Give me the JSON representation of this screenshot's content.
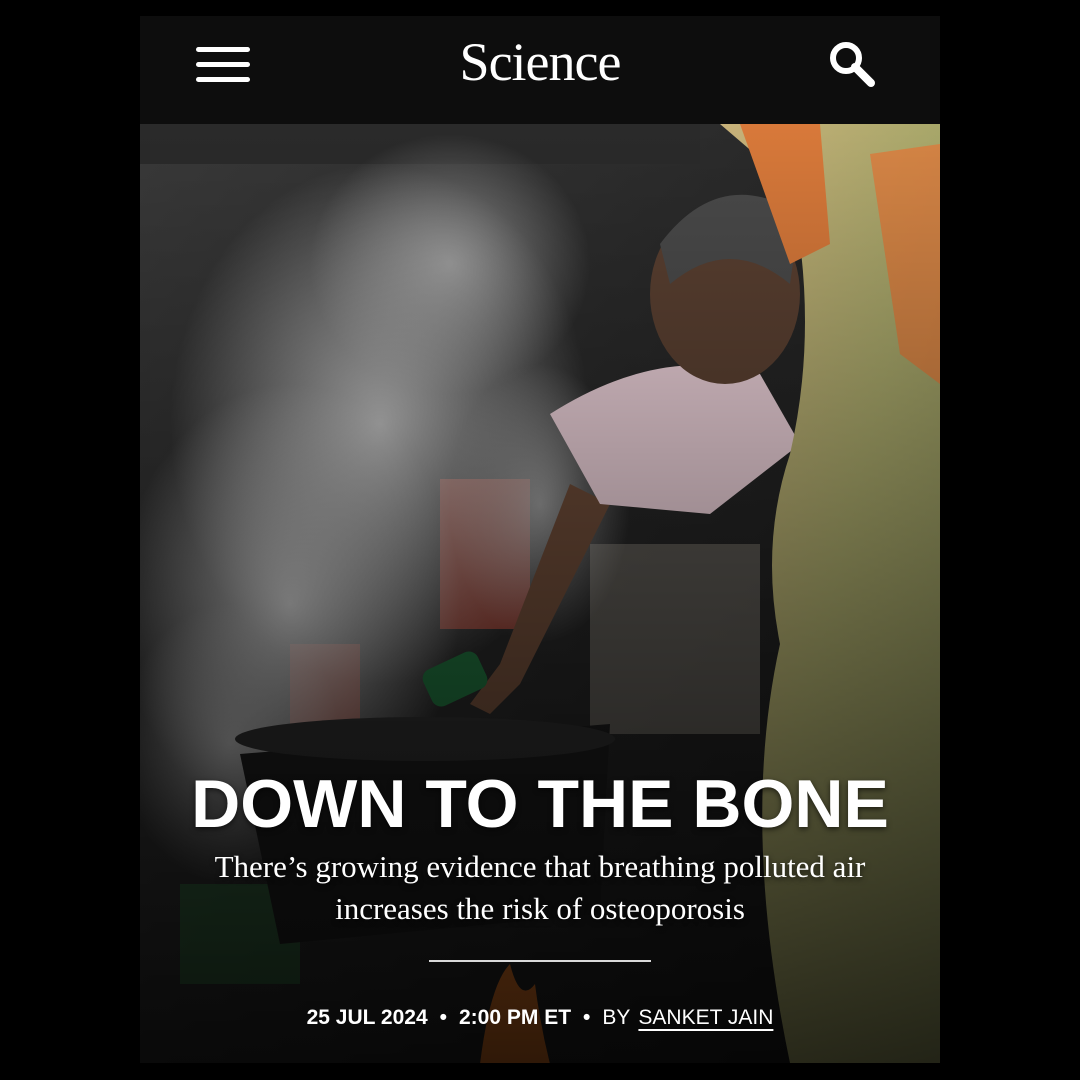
{
  "header": {
    "logo": "Science",
    "menu_icon": "hamburger-menu-icon",
    "search_icon": "search-icon"
  },
  "article": {
    "headline": "DOWN TO THE BONE",
    "dek": "There’s growing evidence that breathing polluted air increases the risk of osteoporosis",
    "date": "25 JUL 2024",
    "time": "2:00 PM ET",
    "byline_prefix": "BY",
    "author": "SANKET JAIN",
    "separator": "•"
  },
  "colors": {
    "background": "#000000",
    "header_bg": "#0d0d0d",
    "text": "#ffffff"
  }
}
